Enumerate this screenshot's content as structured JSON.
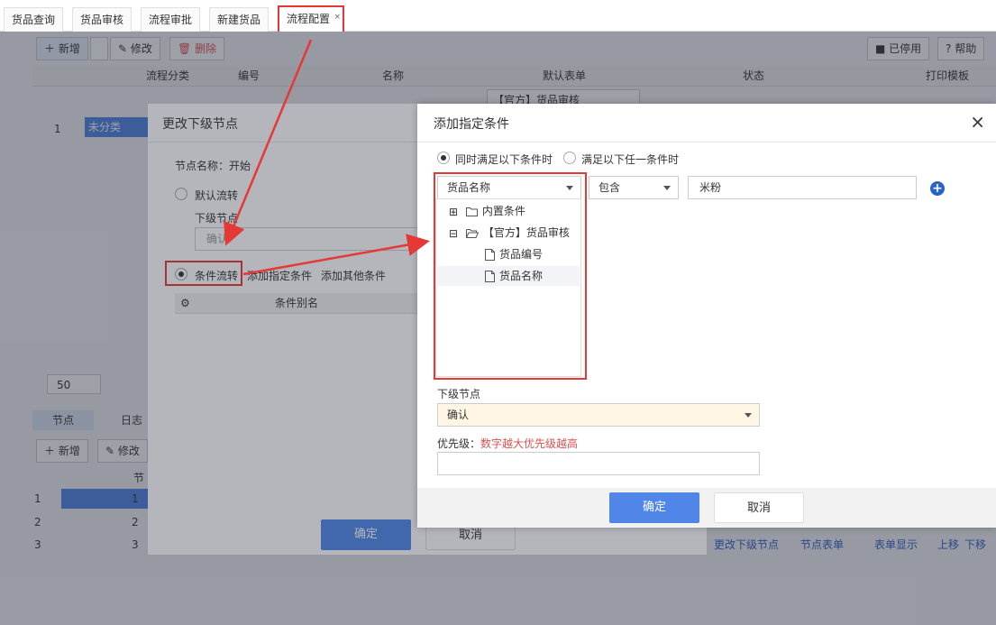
{
  "tabs": [
    {
      "label": "货品查询"
    },
    {
      "label": "货品审核"
    },
    {
      "label": "流程审批"
    },
    {
      "label": "新建货品"
    },
    {
      "label": "流程配置",
      "active": true
    }
  ],
  "tab_close": "×",
  "toolbar": {
    "add": "新增",
    "edit": "修改",
    "delete": "删除",
    "disabled": "已停用",
    "help": "帮助"
  },
  "grid": {
    "columns": [
      "流程分类",
      "编号",
      "名称",
      "默认表单",
      "状态",
      "打印模板"
    ],
    "filter_default_form": "【官方】货品审核",
    "rows": [
      {
        "num": "1",
        "category": "未分类"
      }
    ],
    "page_size": "50"
  },
  "bottom_panel": {
    "tabs": [
      "节点",
      "日志"
    ],
    "add": "新增",
    "edit": "修改",
    "rows": [
      "1",
      "2",
      "3"
    ],
    "col_header_partial": "节",
    "links": [
      "更改下级节点",
      "节点表单",
      "表单显示",
      "上移",
      "下移"
    ]
  },
  "dialog_change_node": {
    "title": "更改下级节点",
    "node_name": "节点名称：开始",
    "option_default": "默认流转",
    "next_node_label": "下级节点",
    "next_node_value": "确认",
    "option_condition": "条件流转",
    "link_add_specified": "添加指定条件",
    "link_add_other": "添加其他条件",
    "table_header": "条件别名",
    "ok": "确定",
    "cancel": "取消"
  },
  "dialog_add_condition": {
    "title": "添加指定条件",
    "close": "×",
    "match_all": "同时满足以下条件时",
    "match_any": "满足以下任一条件时",
    "field_select": "货品名称",
    "operator_select": "包含",
    "value_input": "米粉",
    "tree": [
      {
        "label": "内置条件",
        "level": 0,
        "type": "folder",
        "expander": "⊞"
      },
      {
        "label": "【官方】货品审核",
        "level": 0,
        "type": "folder-open",
        "expander": "⊟"
      },
      {
        "label": "货品编号",
        "level": 1,
        "type": "file"
      },
      {
        "label": "货品名称",
        "level": 1,
        "type": "file",
        "selected": true
      }
    ],
    "next_node_label": "下级节点",
    "next_node_value": "确认",
    "priority_label": "优先级：",
    "priority_hint": "数字越大优先级越高",
    "ok": "确定",
    "cancel": "取消"
  },
  "colors": {
    "accent": "#4f86e8",
    "annotation": "#e53935",
    "link": "#2a62c9",
    "hint": "#d9534f"
  }
}
